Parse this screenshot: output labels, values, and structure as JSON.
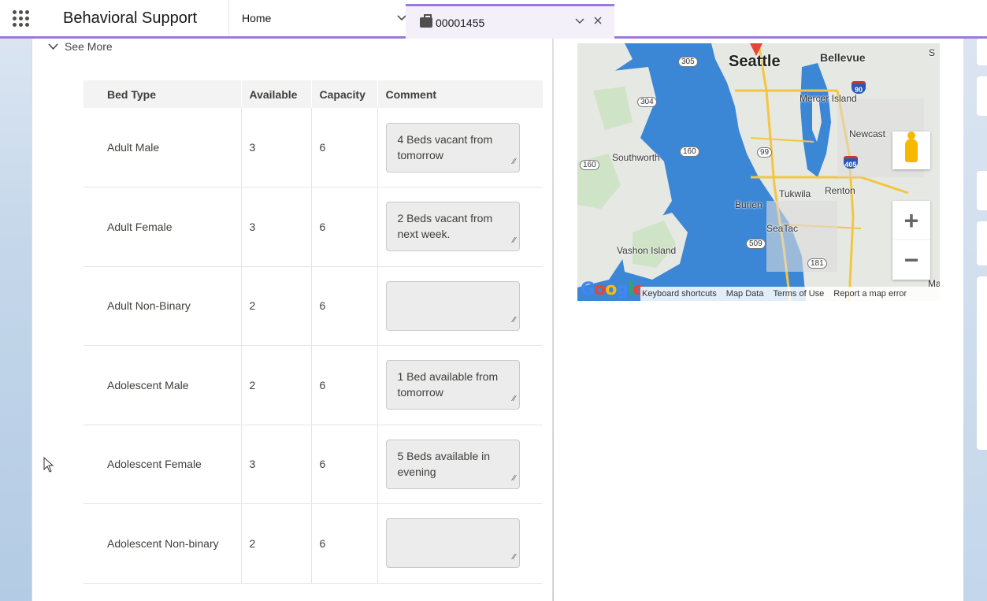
{
  "header": {
    "app_name": "Behavioral Support",
    "nav_home": "Home",
    "nav_chevron": "⌄",
    "record_tab": {
      "label": "00001455",
      "actions": [
        "⌄",
        "✕"
      ]
    }
  },
  "section": {
    "see_more": "See More"
  },
  "table": {
    "columns": [
      "Bed Type",
      "Available",
      "Capacity",
      "Comment"
    ],
    "rows": [
      {
        "bed_type": "Adult Male",
        "available": "3",
        "capacity": "6",
        "comment": "4 Beds vacant from tomorrow"
      },
      {
        "bed_type": "Adult Female",
        "available": "3",
        "capacity": "6",
        "comment": "2 Beds vacant from next week."
      },
      {
        "bed_type": "Adult Non-Binary",
        "available": "2",
        "capacity": "6",
        "comment": ""
      },
      {
        "bed_type": "Adolescent Male",
        "available": "2",
        "capacity": "6",
        "comment": "1 Bed available from tomorrow"
      },
      {
        "bed_type": "Adolescent Female",
        "available": "3",
        "capacity": "6",
        "comment": "5 Beds available in evening"
      },
      {
        "bed_type": "Adolescent Non-binary",
        "available": "2",
        "capacity": "6",
        "comment": ""
      }
    ]
  },
  "map": {
    "places": {
      "seattle": "Seattle",
      "bellevue": "Bellevue",
      "mercer_island": "Mercer Island",
      "newcastle": "Newcast",
      "southworth": "Southworth",
      "tukwila": "Tukwila",
      "renton": "Renton",
      "burien": "Burien",
      "seatac": "SeaTac",
      "vashon_island": "Vashon Island",
      "ma": "Ma",
      "s": "S"
    },
    "routes": {
      "r305": "305",
      "r304": "304",
      "r160a": "160",
      "r160b": "160",
      "r99": "99",
      "r509": "509",
      "r181": "181",
      "i90": "90",
      "i405": "405"
    },
    "logo": "Google",
    "footer": [
      "Keyboard shortcuts",
      "Map Data",
      "Terms of Use",
      "Report a map error"
    ],
    "zoom_in": "+",
    "zoom_out": "−"
  },
  "colors": {
    "accent": "#9b79d7",
    "water": "#3b87d6",
    "land": "#e8ebe6"
  }
}
